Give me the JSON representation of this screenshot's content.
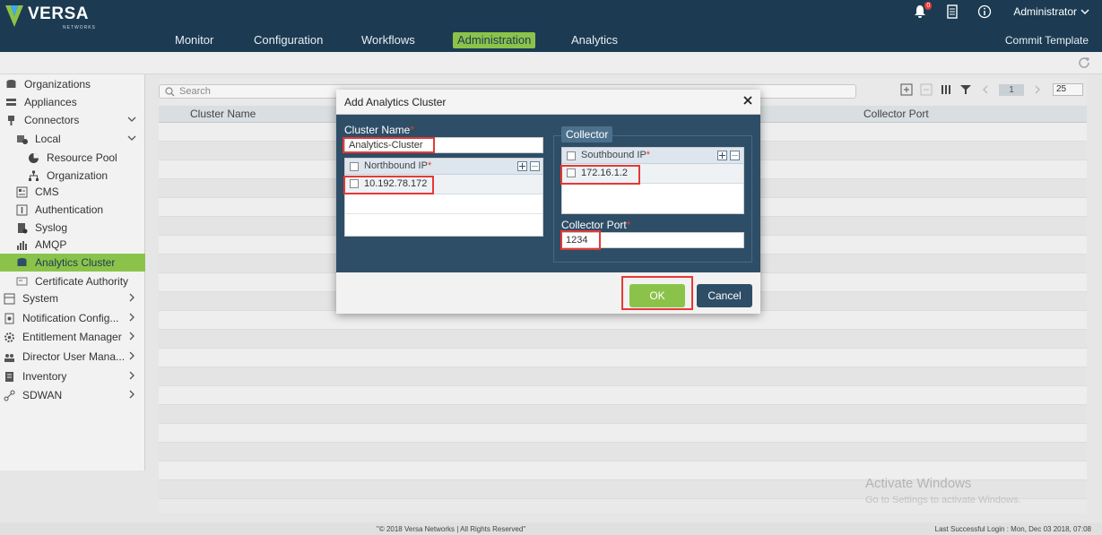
{
  "brand": {
    "name": "VERSA",
    "sub": "NETWORKS"
  },
  "header": {
    "nav": [
      "Monitor",
      "Configuration",
      "Workflows",
      "Administration",
      "Analytics"
    ],
    "active_nav": "Administration",
    "notification_count": "0",
    "user": "Administrator",
    "commit_template": "Commit Template"
  },
  "sidebar": {
    "items": [
      {
        "label": "Organizations"
      },
      {
        "label": "Appliances"
      },
      {
        "label": "Connectors"
      },
      {
        "label": "Local"
      },
      {
        "label": "Resource Pool"
      },
      {
        "label": "Organization"
      },
      {
        "label": "CMS"
      },
      {
        "label": "Authentication"
      },
      {
        "label": "Syslog"
      },
      {
        "label": "AMQP"
      },
      {
        "label": "Analytics Cluster"
      },
      {
        "label": "Certificate Authority"
      },
      {
        "label": "System"
      },
      {
        "label": "Notification Config..."
      },
      {
        "label": "Entitlement Manager"
      },
      {
        "label": "Director User Mana..."
      },
      {
        "label": "Inventory"
      },
      {
        "label": "SDWAN"
      }
    ],
    "active": "Analytics Cluster"
  },
  "grid": {
    "search_placeholder": "Search",
    "page": "1",
    "page_size": "25",
    "columns": [
      "Cluster Name",
      "Collector Port"
    ]
  },
  "modal": {
    "title": "Add Analytics Cluster",
    "cluster_name_label": "Cluster Name",
    "cluster_name_value": "Analytics-Cluster",
    "northbound_header": "Northbound IP",
    "northbound_rows": [
      "10.192.78.172"
    ],
    "collector_legend": "Collector",
    "southbound_header": "Southbound IP",
    "southbound_rows": [
      "172.16.1.2"
    ],
    "collector_port_label": "Collector Port",
    "collector_port_value": "1234",
    "ok_label": "OK",
    "cancel_label": "Cancel",
    "required_mark": "*"
  },
  "footer": {
    "copyright": "\"© 2018 Versa Networks | All Rights Reserved\"",
    "last_login": "Last Successful Login : Mon, Dec 03 2018, 07:08"
  },
  "watermark": {
    "line1": "Activate Windows",
    "line2": "Go to Settings to activate Windows."
  },
  "colors": {
    "header_bg": "#1c3b52",
    "accent_green": "#8bc34a",
    "modal_body": "#2e4e67",
    "highlight_red": "#e53935"
  }
}
